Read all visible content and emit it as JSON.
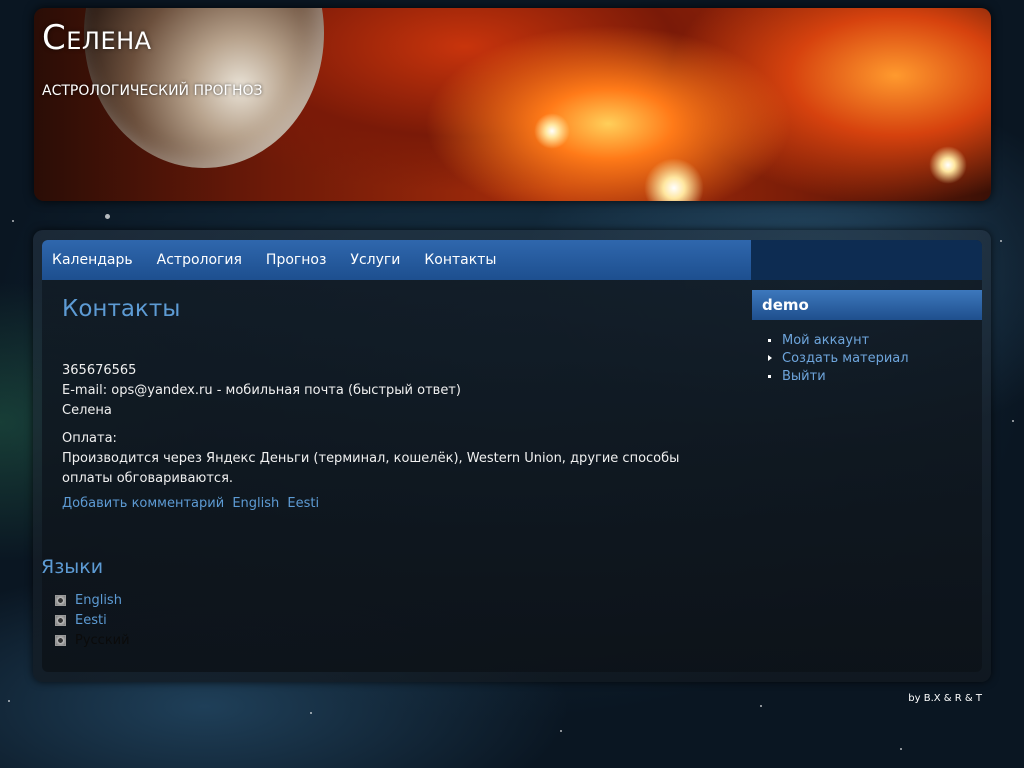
{
  "site": {
    "title": "Селена",
    "slogan": "Астрологический прогноз"
  },
  "nav": {
    "items": [
      {
        "label": "Календарь"
      },
      {
        "label": "Астрология"
      },
      {
        "label": "Прогноз"
      },
      {
        "label": "Услуги"
      },
      {
        "label": "Контакты"
      }
    ]
  },
  "page": {
    "title": "Контакты",
    "phone": "365676565",
    "email_line": "E-mail: ops@yandex.ru - мобильная почта (быстрый ответ)",
    "name": "Селена",
    "payment_label": "Оплата:",
    "payment_text": "Производится через Яндекс Деньги (терминал, кошелёк), Western Union, другие способы оплаты обговариваются.",
    "links": {
      "add_comment": "Добавить комментарий",
      "english": "English",
      "eesti": "Eesti"
    }
  },
  "languages": {
    "title": "Языки",
    "items": [
      {
        "label": "English"
      },
      {
        "label": "Eesti"
      },
      {
        "label": "Русский"
      }
    ]
  },
  "sidebar": {
    "title": "demo",
    "items": [
      {
        "label": "Мой аккаунт"
      },
      {
        "label": "Создать материал"
      },
      {
        "label": "Выйти"
      }
    ]
  },
  "footer": {
    "credit": "by B.X & R & T"
  },
  "colors": {
    "link": "#5d9bd4",
    "nav_bg": "#2f67ad",
    "block_title_bg": "#3d78bd"
  }
}
